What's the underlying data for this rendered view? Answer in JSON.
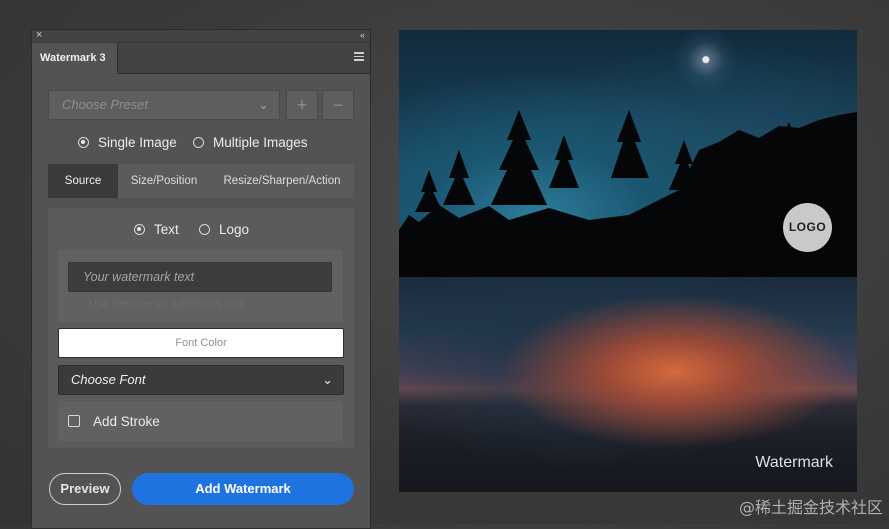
{
  "panel": {
    "tab_title": "Watermark 3",
    "close_glyph": "×",
    "collapse_glyph": "‹‹",
    "preset": {
      "placeholder": "Choose Preset",
      "add_label": "+",
      "remove_label": "−"
    },
    "mode": {
      "option_single": "Single Image",
      "option_multiple": "Multiple Images",
      "selected": "Single Image"
    },
    "subtabs": [
      "Source",
      "Size/Position",
      "Resize/Sharpen/Action"
    ],
    "source": {
      "type_text": "Text",
      "type_logo": "Logo",
      "selected_type": "Text",
      "watermark_placeholder": "Your watermark text",
      "use_filename_label": "Use filename as watermark text",
      "font_color_label": "Font Color",
      "font_select_label": "Choose Font",
      "add_stroke_label": "Add Stroke"
    },
    "preview_label": "Preview",
    "add_watermark_label": "Add Watermark"
  },
  "preview": {
    "logo_label": "LOGO",
    "watermark_label": "Watermark"
  },
  "footer_watermark": "@稀土掘金技术社区",
  "colors": {
    "accent": "#1f73e0",
    "panel_bg": "#535353",
    "page_bg": "#3a3a3a"
  }
}
